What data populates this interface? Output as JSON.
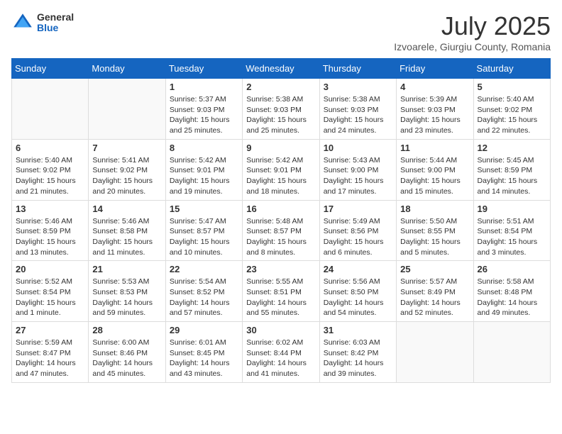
{
  "header": {
    "logo_general": "General",
    "logo_blue": "Blue",
    "month": "July 2025",
    "location": "Izvoarele, Giurgiu County, Romania"
  },
  "weekdays": [
    "Sunday",
    "Monday",
    "Tuesday",
    "Wednesday",
    "Thursday",
    "Friday",
    "Saturday"
  ],
  "weeks": [
    [
      {
        "day": "",
        "info": ""
      },
      {
        "day": "",
        "info": ""
      },
      {
        "day": "1",
        "info": "Sunrise: 5:37 AM\nSunset: 9:03 PM\nDaylight: 15 hours\nand 25 minutes."
      },
      {
        "day": "2",
        "info": "Sunrise: 5:38 AM\nSunset: 9:03 PM\nDaylight: 15 hours\nand 25 minutes."
      },
      {
        "day": "3",
        "info": "Sunrise: 5:38 AM\nSunset: 9:03 PM\nDaylight: 15 hours\nand 24 minutes."
      },
      {
        "day": "4",
        "info": "Sunrise: 5:39 AM\nSunset: 9:03 PM\nDaylight: 15 hours\nand 23 minutes."
      },
      {
        "day": "5",
        "info": "Sunrise: 5:40 AM\nSunset: 9:02 PM\nDaylight: 15 hours\nand 22 minutes."
      }
    ],
    [
      {
        "day": "6",
        "info": "Sunrise: 5:40 AM\nSunset: 9:02 PM\nDaylight: 15 hours\nand 21 minutes."
      },
      {
        "day": "7",
        "info": "Sunrise: 5:41 AM\nSunset: 9:02 PM\nDaylight: 15 hours\nand 20 minutes."
      },
      {
        "day": "8",
        "info": "Sunrise: 5:42 AM\nSunset: 9:01 PM\nDaylight: 15 hours\nand 19 minutes."
      },
      {
        "day": "9",
        "info": "Sunrise: 5:42 AM\nSunset: 9:01 PM\nDaylight: 15 hours\nand 18 minutes."
      },
      {
        "day": "10",
        "info": "Sunrise: 5:43 AM\nSunset: 9:00 PM\nDaylight: 15 hours\nand 17 minutes."
      },
      {
        "day": "11",
        "info": "Sunrise: 5:44 AM\nSunset: 9:00 PM\nDaylight: 15 hours\nand 15 minutes."
      },
      {
        "day": "12",
        "info": "Sunrise: 5:45 AM\nSunset: 8:59 PM\nDaylight: 15 hours\nand 14 minutes."
      }
    ],
    [
      {
        "day": "13",
        "info": "Sunrise: 5:46 AM\nSunset: 8:59 PM\nDaylight: 15 hours\nand 13 minutes."
      },
      {
        "day": "14",
        "info": "Sunrise: 5:46 AM\nSunset: 8:58 PM\nDaylight: 15 hours\nand 11 minutes."
      },
      {
        "day": "15",
        "info": "Sunrise: 5:47 AM\nSunset: 8:57 PM\nDaylight: 15 hours\nand 10 minutes."
      },
      {
        "day": "16",
        "info": "Sunrise: 5:48 AM\nSunset: 8:57 PM\nDaylight: 15 hours\nand 8 minutes."
      },
      {
        "day": "17",
        "info": "Sunrise: 5:49 AM\nSunset: 8:56 PM\nDaylight: 15 hours\nand 6 minutes."
      },
      {
        "day": "18",
        "info": "Sunrise: 5:50 AM\nSunset: 8:55 PM\nDaylight: 15 hours\nand 5 minutes."
      },
      {
        "day": "19",
        "info": "Sunrise: 5:51 AM\nSunset: 8:54 PM\nDaylight: 15 hours\nand 3 minutes."
      }
    ],
    [
      {
        "day": "20",
        "info": "Sunrise: 5:52 AM\nSunset: 8:54 PM\nDaylight: 15 hours\nand 1 minute."
      },
      {
        "day": "21",
        "info": "Sunrise: 5:53 AM\nSunset: 8:53 PM\nDaylight: 14 hours\nand 59 minutes."
      },
      {
        "day": "22",
        "info": "Sunrise: 5:54 AM\nSunset: 8:52 PM\nDaylight: 14 hours\nand 57 minutes."
      },
      {
        "day": "23",
        "info": "Sunrise: 5:55 AM\nSunset: 8:51 PM\nDaylight: 14 hours\nand 55 minutes."
      },
      {
        "day": "24",
        "info": "Sunrise: 5:56 AM\nSunset: 8:50 PM\nDaylight: 14 hours\nand 54 minutes."
      },
      {
        "day": "25",
        "info": "Sunrise: 5:57 AM\nSunset: 8:49 PM\nDaylight: 14 hours\nand 52 minutes."
      },
      {
        "day": "26",
        "info": "Sunrise: 5:58 AM\nSunset: 8:48 PM\nDaylight: 14 hours\nand 49 minutes."
      }
    ],
    [
      {
        "day": "27",
        "info": "Sunrise: 5:59 AM\nSunset: 8:47 PM\nDaylight: 14 hours\nand 47 minutes."
      },
      {
        "day": "28",
        "info": "Sunrise: 6:00 AM\nSunset: 8:46 PM\nDaylight: 14 hours\nand 45 minutes."
      },
      {
        "day": "29",
        "info": "Sunrise: 6:01 AM\nSunset: 8:45 PM\nDaylight: 14 hours\nand 43 minutes."
      },
      {
        "day": "30",
        "info": "Sunrise: 6:02 AM\nSunset: 8:44 PM\nDaylight: 14 hours\nand 41 minutes."
      },
      {
        "day": "31",
        "info": "Sunrise: 6:03 AM\nSunset: 8:42 PM\nDaylight: 14 hours\nand 39 minutes."
      },
      {
        "day": "",
        "info": ""
      },
      {
        "day": "",
        "info": ""
      }
    ]
  ]
}
